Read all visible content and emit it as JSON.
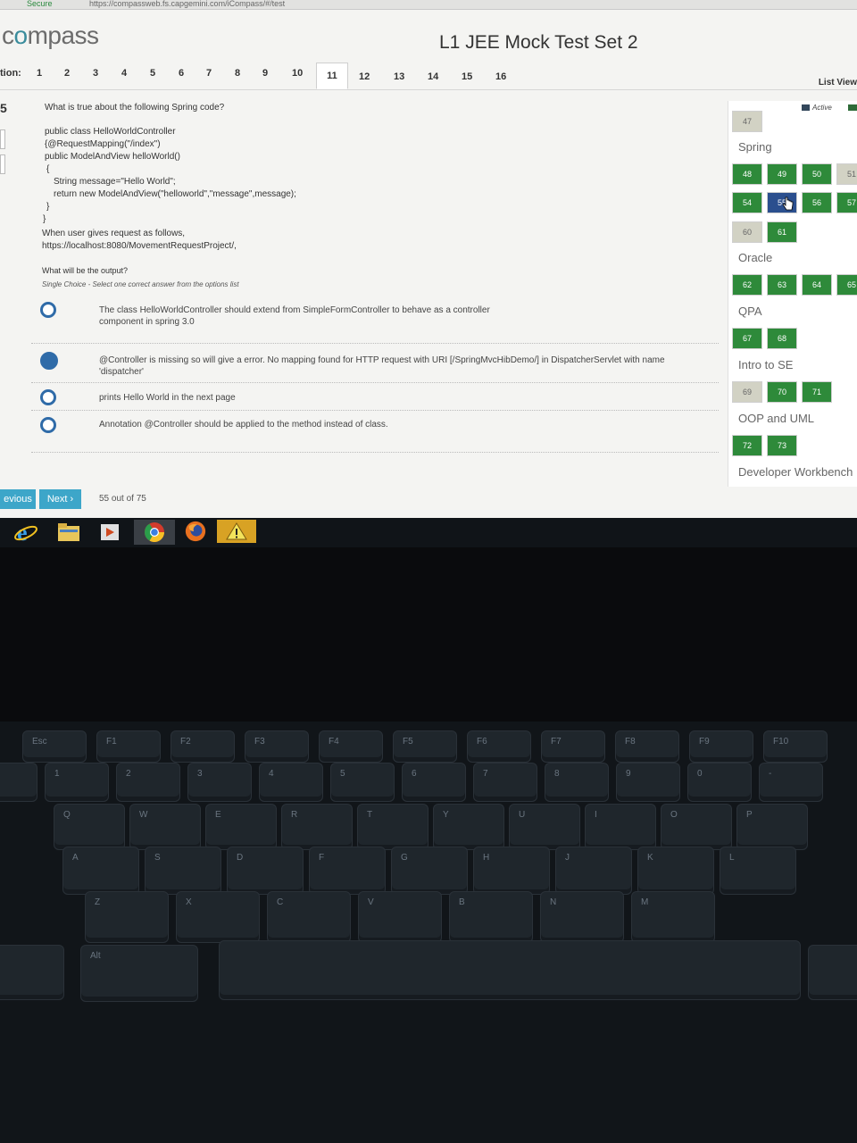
{
  "browser": {
    "secure_label": "Secure",
    "url": "https://compassweb.fs.capgemini.com/iCompass/#/test"
  },
  "app": {
    "logo": "compass",
    "title": "L1 JEE Mock Test Set 2"
  },
  "question_bar": {
    "label": "tion:",
    "numbers": [
      "1",
      "2",
      "3",
      "4",
      "5",
      "6",
      "7",
      "8",
      "9",
      "10",
      "11",
      "12",
      "13",
      "14",
      "15",
      "16"
    ],
    "active": "11",
    "list_view": "List View"
  },
  "question": {
    "number": "5",
    "prompt": "What is true about the following Spring code?",
    "code": [
      "public class HelloWorldController",
      "{@RequestMapping(\"/index\")",
      " public ModelAndView helloWorld()",
      " {",
      "  String message=\"Hello World\";",
      "  return new ModelAndView(\"helloworld\",\"message\",message);",
      " }",
      "}",
      "When user gives request as follows,",
      "https://localhost:8080/MovementRequestProject/,"
    ],
    "output_prompt": "What will be the output?",
    "hint": "Single Choice - Select one correct answer from the options list",
    "options": [
      {
        "text": "The class HelloWorldController should extend from SimpleFormController to behave as a controller component in spring 3.0",
        "selected": false
      },
      {
        "text": "@Controller is missing so will give a error. No mapping found for HTTP request with URI [/SpringMvcHibDemo/] in DispatcherServlet with name 'dispatcher'",
        "selected": true
      },
      {
        "text": "prints Hello World in the next page",
        "selected": false
      },
      {
        "text": "Annotation @Controller should be applied to the method instead of class.",
        "selected": false
      }
    ]
  },
  "nav": {
    "previous": "evious",
    "next": "Next ›",
    "progress": "55 out of 75"
  },
  "palette": {
    "legend_active": "Active",
    "sections": [
      {
        "name": "",
        "tiles": [
          {
            "n": "47",
            "state": "gray"
          }
        ]
      },
      {
        "name": "Spring",
        "tiles": [
          {
            "n": "48",
            "state": "green"
          },
          {
            "n": "49",
            "state": "green"
          },
          {
            "n": "50",
            "state": "green"
          },
          {
            "n": "51",
            "state": "gray"
          },
          {
            "n": "54",
            "state": "green"
          },
          {
            "n": "55",
            "state": "current"
          },
          {
            "n": "56",
            "state": "green"
          },
          {
            "n": "57",
            "state": "green"
          },
          {
            "n": "60",
            "state": "gray"
          },
          {
            "n": "61",
            "state": "green"
          }
        ]
      },
      {
        "name": "Oracle",
        "tiles": [
          {
            "n": "62",
            "state": "green"
          },
          {
            "n": "63",
            "state": "green"
          },
          {
            "n": "64",
            "state": "green"
          },
          {
            "n": "65",
            "state": "green"
          }
        ]
      },
      {
        "name": "QPA",
        "tiles": [
          {
            "n": "67",
            "state": "green"
          },
          {
            "n": "68",
            "state": "green"
          }
        ]
      },
      {
        "name": "Intro to SE",
        "tiles": [
          {
            "n": "69",
            "state": "gray"
          },
          {
            "n": "70",
            "state": "green"
          },
          {
            "n": "71",
            "state": "green"
          }
        ]
      },
      {
        "name": "OOP and UML",
        "tiles": [
          {
            "n": "72",
            "state": "green"
          },
          {
            "n": "73",
            "state": "green"
          }
        ]
      },
      {
        "name": "Developer Workbench",
        "tiles": []
      }
    ]
  },
  "taskbar": [
    "internet-explorer-icon",
    "file-explorer-icon",
    "media-player-icon",
    "chrome-icon",
    "firefox-icon",
    "warning-icon"
  ],
  "keyboard": {
    "fn_row": [
      "Esc",
      "F1",
      "F2",
      "F3",
      "F4",
      "F5",
      "F6",
      "F7",
      "F8",
      "F9",
      "F10"
    ],
    "num_row": [
      "~",
      "1",
      "2",
      "3",
      "4",
      "5",
      "6",
      "7",
      "8",
      "9",
      "0",
      "-"
    ],
    "num_row_shift": [
      "",
      "!",
      "@",
      "#",
      "$",
      "%",
      "^",
      "&",
      "*",
      "(",
      ")",
      "_"
    ],
    "row_q": [
      "Q",
      "W",
      "E",
      "R",
      "T",
      "Y",
      "U",
      "I",
      "O",
      "P"
    ],
    "row_a": [
      "A",
      "S",
      "D",
      "F",
      "G",
      "H",
      "J",
      "K",
      "L"
    ],
    "row_z": [
      "Z",
      "X",
      "C",
      "V",
      "B",
      "N",
      "M"
    ],
    "alt": "Alt"
  }
}
